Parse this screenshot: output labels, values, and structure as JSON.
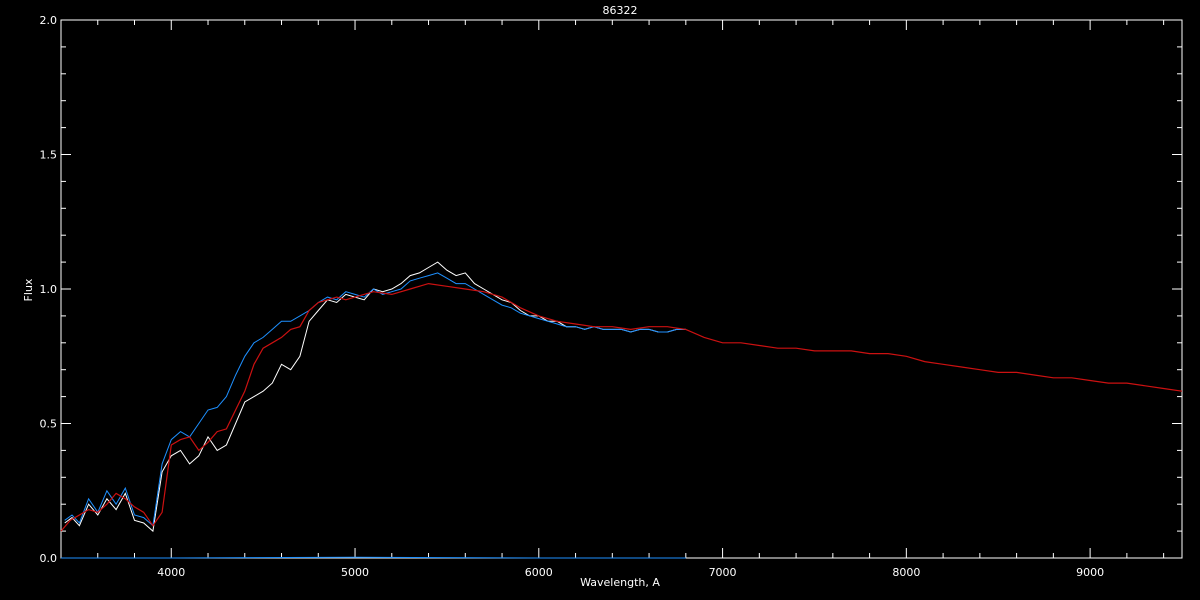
{
  "chart_data": {
    "type": "line",
    "title": "86322",
    "xlabel": "Wavelength, A",
    "ylabel": "Flux",
    "xlim": [
      3400,
      9500
    ],
    "ylim": [
      0.0,
      2.0
    ],
    "xticks": [
      4000,
      5000,
      6000,
      7000,
      8000,
      9000
    ],
    "xtick_labels": [
      "4000",
      "5000",
      "6000",
      "7000",
      "8000",
      "9000"
    ],
    "yticks": [
      0.0,
      0.5,
      1.0,
      1.5,
      2.0
    ],
    "ytick_labels": [
      "0.0",
      "0.5",
      "1.0",
      "1.5",
      "2.0"
    ],
    "grid": false,
    "background": "#000000",
    "axis_color": "#ffffff",
    "series": [
      {
        "color": "#ffffff",
        "x": [
          3420,
          3460,
          3500,
          3550,
          3600,
          3650,
          3700,
          3750,
          3800,
          3850,
          3900,
          3950,
          4000,
          4050,
          4100,
          4150,
          4200,
          4250,
          4300,
          4350,
          4400,
          4450,
          4500,
          4550,
          4600,
          4650,
          4700,
          4750,
          4800,
          4850,
          4900,
          4950,
          5000,
          5050,
          5100,
          5150,
          5200,
          5250,
          5300,
          5350,
          5400,
          5450,
          5500,
          5550,
          5600,
          5650,
          5700,
          5750,
          5800,
          5850,
          5900,
          5950,
          6000,
          6050,
          6100,
          6150,
          6200,
          6250,
          6300,
          6350,
          6400,
          6450,
          6500,
          6550,
          6600,
          6650,
          6700,
          6750,
          6800
        ],
        "values": [
          0.13,
          0.15,
          0.12,
          0.2,
          0.16,
          0.22,
          0.18,
          0.24,
          0.14,
          0.13,
          0.1,
          0.32,
          0.38,
          0.4,
          0.35,
          0.38,
          0.45,
          0.4,
          0.42,
          0.5,
          0.58,
          0.6,
          0.62,
          0.65,
          0.72,
          0.7,
          0.75,
          0.88,
          0.92,
          0.96,
          0.95,
          0.98,
          0.97,
          0.96,
          1.0,
          0.99,
          1.0,
          1.02,
          1.05,
          1.06,
          1.08,
          1.1,
          1.07,
          1.05,
          1.06,
          1.02,
          1.0,
          0.98,
          0.96,
          0.95,
          0.92,
          0.9,
          0.9,
          0.88,
          0.88,
          0.86,
          0.86,
          0.85,
          0.86,
          0.85,
          0.85,
          0.85,
          0.84,
          0.85,
          0.85,
          0.84,
          0.84,
          0.85,
          0.85
        ]
      },
      {
        "color": "#1e90ff",
        "x": [
          3420,
          3460,
          3500,
          3550,
          3600,
          3650,
          3700,
          3750,
          3800,
          3850,
          3900,
          3950,
          4000,
          4050,
          4100,
          4150,
          4200,
          4250,
          4300,
          4350,
          4400,
          4450,
          4500,
          4550,
          4600,
          4650,
          4700,
          4750,
          4800,
          4850,
          4900,
          4950,
          5000,
          5050,
          5100,
          5150,
          5200,
          5250,
          5300,
          5350,
          5400,
          5450,
          5500,
          5550,
          5600,
          5650,
          5700,
          5750,
          5800,
          5850,
          5900,
          5950,
          6000,
          6050,
          6100,
          6150,
          6200,
          6250,
          6300,
          6350,
          6400,
          6450,
          6500,
          6550,
          6600,
          6650,
          6700,
          6750,
          6800
        ],
        "values": [
          0.14,
          0.16,
          0.13,
          0.22,
          0.17,
          0.25,
          0.2,
          0.26,
          0.16,
          0.15,
          0.12,
          0.35,
          0.44,
          0.47,
          0.45,
          0.5,
          0.55,
          0.56,
          0.6,
          0.68,
          0.75,
          0.8,
          0.82,
          0.85,
          0.88,
          0.88,
          0.9,
          0.92,
          0.95,
          0.97,
          0.96,
          0.99,
          0.98,
          0.97,
          1.0,
          0.98,
          0.99,
          1.0,
          1.03,
          1.04,
          1.05,
          1.06,
          1.04,
          1.02,
          1.02,
          1.0,
          0.98,
          0.96,
          0.94,
          0.93,
          0.91,
          0.9,
          0.89,
          0.88,
          0.87,
          0.86,
          0.86,
          0.85,
          0.86,
          0.85,
          0.85,
          0.85,
          0.84,
          0.85,
          0.85,
          0.84,
          0.84,
          0.85,
          0.85
        ]
      },
      {
        "color": "#cc1111",
        "x": [
          3400,
          3450,
          3500,
          3550,
          3600,
          3650,
          3700,
          3750,
          3800,
          3850,
          3900,
          3950,
          4000,
          4050,
          4100,
          4150,
          4200,
          4250,
          4300,
          4350,
          4400,
          4450,
          4500,
          4550,
          4600,
          4650,
          4700,
          4750,
          4800,
          4850,
          4900,
          4950,
          5000,
          5100,
          5200,
          5300,
          5400,
          5500,
          5600,
          5700,
          5800,
          5900,
          6000,
          6100,
          6200,
          6300,
          6400,
          6500,
          6600,
          6700,
          6800,
          6900,
          7000,
          7100,
          7200,
          7300,
          7400,
          7500,
          7600,
          7700,
          7800,
          7900,
          8000,
          8100,
          8200,
          8300,
          8400,
          8500,
          8600,
          8700,
          8800,
          8900,
          9000,
          9100,
          9200,
          9300,
          9400,
          9500
        ],
        "values": [
          0.1,
          0.14,
          0.16,
          0.18,
          0.17,
          0.2,
          0.24,
          0.22,
          0.19,
          0.17,
          0.12,
          0.17,
          0.42,
          0.44,
          0.45,
          0.4,
          0.43,
          0.47,
          0.48,
          0.55,
          0.62,
          0.72,
          0.78,
          0.8,
          0.82,
          0.85,
          0.86,
          0.92,
          0.95,
          0.96,
          0.97,
          0.96,
          0.97,
          0.99,
          0.98,
          1.0,
          1.02,
          1.01,
          1.0,
          0.99,
          0.97,
          0.93,
          0.9,
          0.88,
          0.87,
          0.86,
          0.86,
          0.85,
          0.86,
          0.86,
          0.85,
          0.82,
          0.8,
          0.8,
          0.79,
          0.78,
          0.78,
          0.77,
          0.77,
          0.77,
          0.76,
          0.76,
          0.75,
          0.73,
          0.72,
          0.71,
          0.7,
          0.69,
          0.69,
          0.68,
          0.67,
          0.67,
          0.66,
          0.65,
          0.65,
          0.64,
          0.63,
          0.62
        ]
      },
      {
        "color": "#1e90ff",
        "x": [
          3400,
          4000,
          5000,
          6000,
          6800
        ],
        "values": [
          0.0,
          0.0,
          0.003,
          0.0,
          0.0
        ]
      }
    ]
  }
}
